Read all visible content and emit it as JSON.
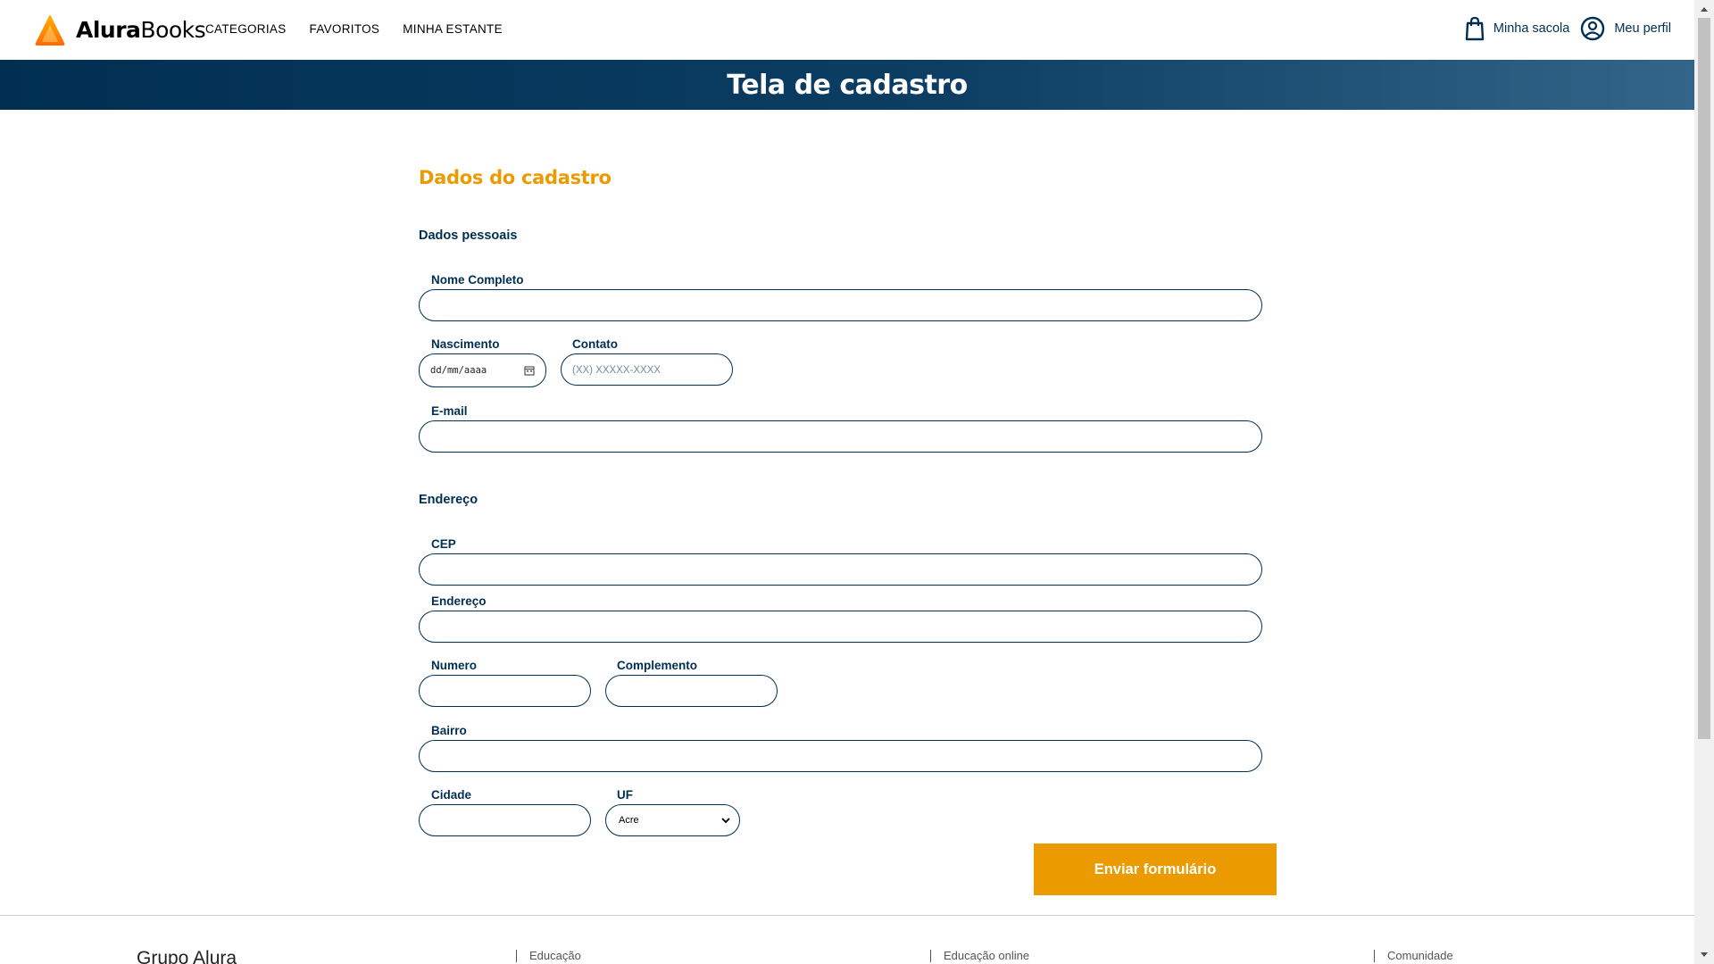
{
  "header": {
    "brand_bold": "Alura",
    "brand_rest": "Books",
    "nav": [
      "CATEGORIAS",
      "FAVORITOS",
      "MINHA ESTANTE"
    ],
    "bag_label": "Minha sacola",
    "profile_label": "Meu perfil",
    "icons": {
      "logo": "alura-triangle-logo",
      "bag": "shopping-bag-icon",
      "profile": "user-circle-icon"
    },
    "colors": {
      "logo_orange": "#eb9b00",
      "logo_red": "#ff5c00"
    }
  },
  "banner": {
    "title": "Tela de cadastro"
  },
  "form": {
    "title": "Dados do cadastro",
    "personal_section": "Dados pessoais",
    "labels": {
      "nome": "Nome Completo",
      "nascimento": "Nascimento",
      "contato": "Contato",
      "email": "E-mail"
    },
    "date_placeholder": "dd/mm/aaaa",
    "contato_placeholder": "(XX) XXXXX-XXXX",
    "address_section": "Endereço",
    "address_labels": {
      "cep": "CEP",
      "endereco": "Endereço",
      "numero": "Numero",
      "complemento": "Complemento",
      "bairro": "Bairro",
      "cidade": "Cidade",
      "uf": "UF"
    },
    "uf_selected": "Acre",
    "submit_label": "Enviar formulário"
  },
  "footer": {
    "brand": "Grupo Alura",
    "links": [
      "Educação",
      "Educação online",
      "Comunidade"
    ]
  },
  "colors": {
    "primary": "#002f52",
    "accent": "#eb9b00",
    "banner_end": "#326589"
  }
}
